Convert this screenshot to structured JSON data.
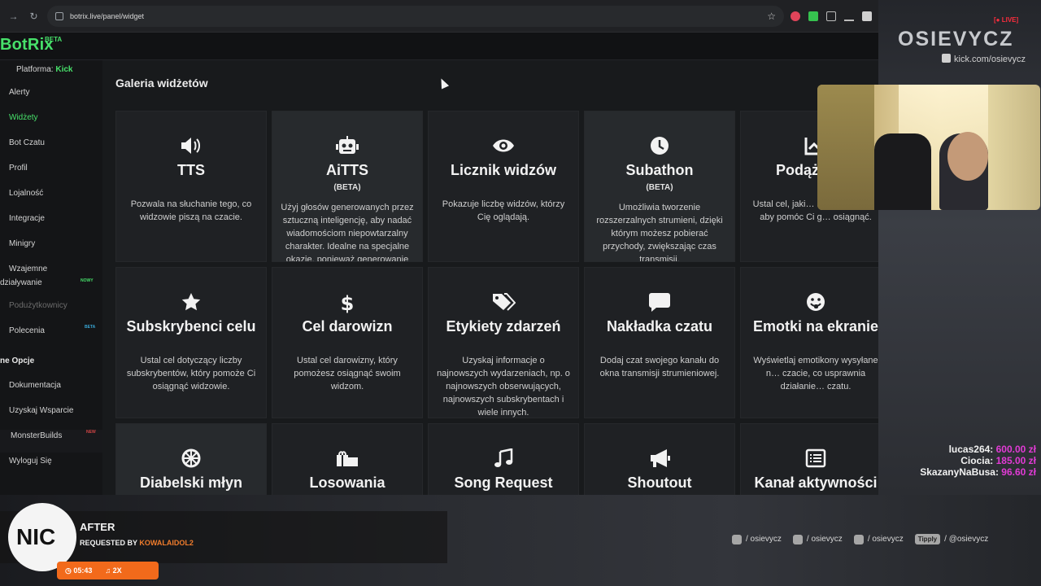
{
  "browser": {
    "url": "botrix.live/panel/widget"
  },
  "app": {
    "logo": "BotRix",
    "logo_badge": "BETA",
    "platform_label": "Platforma:",
    "platform_value": "Kick"
  },
  "sidebar": {
    "items": [
      {
        "label": "Alerty"
      },
      {
        "label": "Widżety"
      },
      {
        "label": "Bot Czatu"
      },
      {
        "label": "Profil"
      },
      {
        "label": "Lojalność"
      },
      {
        "label": "Integracje"
      },
      {
        "label": "Minigry"
      },
      {
        "label": "Wzajemne"
      },
      {
        "label": "działywanie"
      },
      {
        "label": "Podużytkownicy"
      },
      {
        "label": "Polecenia"
      }
    ],
    "badges": {
      "nowy": "NOWY",
      "beta": "BETA",
      "new": "NEW"
    },
    "section_title": "ne Opcje",
    "extra": [
      {
        "label": "Dokumentacja"
      },
      {
        "label": "Uzyskaj Wsparcie"
      },
      {
        "label": "MonsterBuilds"
      },
      {
        "label": "Wyloguj Się"
      }
    ]
  },
  "main": {
    "title": "Galeria widżetów",
    "cards": [
      {
        "title": "TTS",
        "sub": "",
        "desc": "Pozwala na słuchanie tego, co widzowie piszą na czacie.",
        "icon": "volume-icon"
      },
      {
        "title": "AiTTS",
        "sub": "(BETA)",
        "desc": "Użyj głosów generowanych przez sztuczną inteligencję, aby nadać wiadomościom niepowtarzalny charakter. Idealne na specjalne okazje, ponieważ generowanie",
        "icon": "robot-icon"
      },
      {
        "title": "Licznik widzów",
        "sub": "",
        "desc": "Pokazuje liczbę widzów, którzy Cię oglądają.",
        "icon": "eye-icon"
      },
      {
        "title": "Subathon",
        "sub": "(BETA)",
        "desc": "Umożliwia tworzenie rozszerzalnych strumieni, dzięki którym możesz pobierać przychody, zwiększając czas transmisji.",
        "icon": "clock-icon"
      },
      {
        "title": "Podążający",
        "sub": "",
        "desc": "Ustal cel, jaki… obserwujących, aby pomóc Ci g… osiągnąć.",
        "icon": "chart-icon"
      },
      {
        "title": "Subskrybenci celu",
        "sub": "",
        "desc": "Ustal cel dotyczący liczby subskrybentów, który pomoże Ci osiągnąć widzowie.",
        "icon": "star-icon"
      },
      {
        "title": "Cel darowizn",
        "sub": "",
        "desc": "Ustal cel darowizny, który pomożesz osiągnąć swoim widzom.",
        "icon": "dollar-icon"
      },
      {
        "title": "Etykiety zdarzeń",
        "sub": "",
        "desc": "Uzyskaj informacje o najnowszych wydarzeniach, np. o najnowszych obserwujących, najnowszych subskrybentach i wiele innych.",
        "icon": "tags-icon"
      },
      {
        "title": "Nakładka czatu",
        "sub": "",
        "desc": "Dodaj czat swojego kanału do okna transmisji strumieniowej.",
        "icon": "chat-icon"
      },
      {
        "title": "Emotki na ekranie",
        "sub": "",
        "desc": "Wyświetlaj emotikony wysyłane n… czacie, co usprawnia działanie… czatu.",
        "icon": "emoji-icon"
      },
      {
        "title": "Diabelski młyn",
        "sub": "",
        "desc": "",
        "icon": "wheel-icon"
      },
      {
        "title": "Losowania",
        "sub": "",
        "desc": "",
        "icon": "gifts-icon"
      },
      {
        "title": "Song Request",
        "sub": "",
        "desc": "",
        "icon": "music-icon"
      },
      {
        "title": "Shoutout",
        "sub": "",
        "desc": "",
        "icon": "megaphone-icon"
      },
      {
        "title": "Kanał aktywności",
        "sub": "",
        "desc": "",
        "icon": "list-icon"
      }
    ]
  },
  "overlay": {
    "channel": "OSIEVYCZ",
    "live": "LIVE",
    "kick": "kick.com/osievycz",
    "donations": [
      {
        "name": "lucas264:",
        "amount": "600.00 zł"
      },
      {
        "name": "Ciocia:",
        "amount": "185.00 zł"
      },
      {
        "name": "SkazanyNaBusa:",
        "amount": "96.60 zł"
      }
    ],
    "socials": [
      {
        "label": "/ osievycz",
        "icon": "instagram-icon"
      },
      {
        "label": "/ osievycz",
        "icon": "tiktok-icon"
      },
      {
        "label": "/ osievycz",
        "icon": "youtube-icon"
      },
      {
        "label": "/ @osievycz",
        "icon": "tipply-icon",
        "badge": "Tipply"
      }
    ],
    "music": {
      "disc": "NIC",
      "song": "AFTER",
      "requested_by": "REQUESTED BY",
      "requester": "KOWALAIDOL2",
      "time": "05:43",
      "count": "2X"
    }
  }
}
